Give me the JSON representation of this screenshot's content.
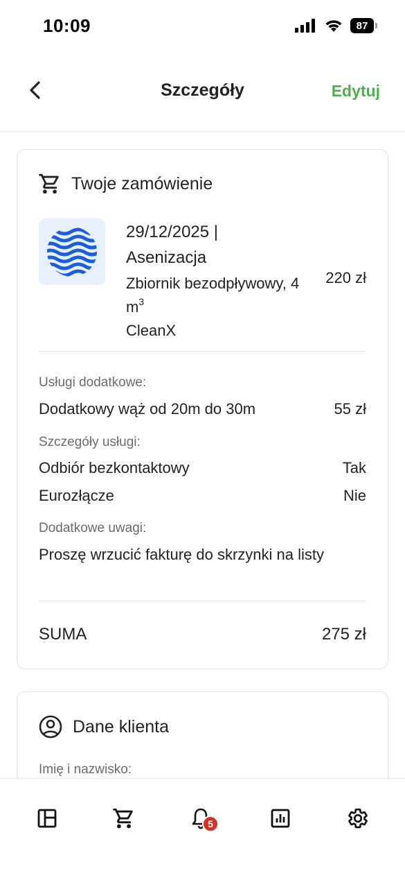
{
  "status_bar": {
    "time": "10:09",
    "battery": "87"
  },
  "nav": {
    "title": "Szczegóły",
    "edit_label": "Edytuj"
  },
  "order_card": {
    "title": "Twoje zamówienie",
    "date_line": "29/12/2025 |",
    "service": "Asenizacja",
    "detail_prefix": "Zbiornik bezodpływowy, 4 m",
    "detail_sup": "3",
    "provider": "CleanX",
    "price": "220 zł",
    "extras_label": "Usługi dodatkowe:",
    "extras": [
      {
        "name": "Dodatkowy wąż od 20m do 30m",
        "value": "55 zł"
      }
    ],
    "details_label": "Szczegóły usługi:",
    "details": [
      {
        "name": "Odbiór bezkontaktowy",
        "value": "Tak"
      },
      {
        "name": "Eurozłącze",
        "value": "Nie"
      }
    ],
    "notes_label": "Dodatkowe uwagi:",
    "notes": "Proszę wrzucić fakturę do skrzynki na listy",
    "sum_label": "SUMA",
    "sum_value": "275 zł"
  },
  "client_card": {
    "title": "Dane klienta",
    "name_label": "Imię i nazwisko:"
  },
  "tab_bar": {
    "tabs": [
      "dashboard-icon",
      "cart-icon",
      "bell-icon",
      "chart-icon",
      "gear-icon"
    ],
    "notifications_badge": "5"
  },
  "colors": {
    "accent": "#4caf50",
    "badge": "#d93025",
    "brand_blue": "#1a5fd9"
  }
}
